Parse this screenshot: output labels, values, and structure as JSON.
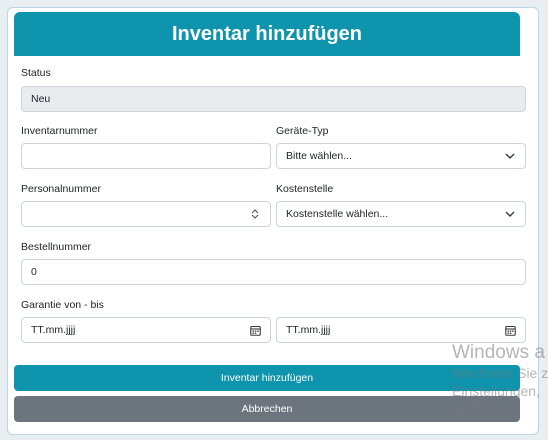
{
  "form": {
    "title": "Inventar hinzufügen",
    "status": {
      "label": "Status",
      "value": "Neu"
    },
    "inventarnummer": {
      "label": "Inventarnummer",
      "value": ""
    },
    "geraete_typ": {
      "label": "Geräte-Typ",
      "selected": "Bitte wählen..."
    },
    "personalnummer": {
      "label": "Personalnummer",
      "value": ""
    },
    "kostenstelle": {
      "label": "Kostenstelle",
      "selected": "Kostenstelle wählen..."
    },
    "bestellnummer": {
      "label": "Bestellnummer",
      "value": "0"
    },
    "garantie": {
      "label": "Garantie von - bis",
      "from_value": "TT.mm.jjjj",
      "to_value": "TT.mm.jjjj"
    },
    "submit_label": "Inventar hinzufügen",
    "cancel_label": "Abbrechen"
  },
  "watermark": {
    "line1": "Windows a",
    "line2": "Wechseln Sie z",
    "line3": "Einstellungen,",
    "line4": "aktivieren."
  },
  "colors": {
    "primary": "#0f94ad",
    "secondary": "#6c757d",
    "readonly_bg": "#e9ecef"
  }
}
